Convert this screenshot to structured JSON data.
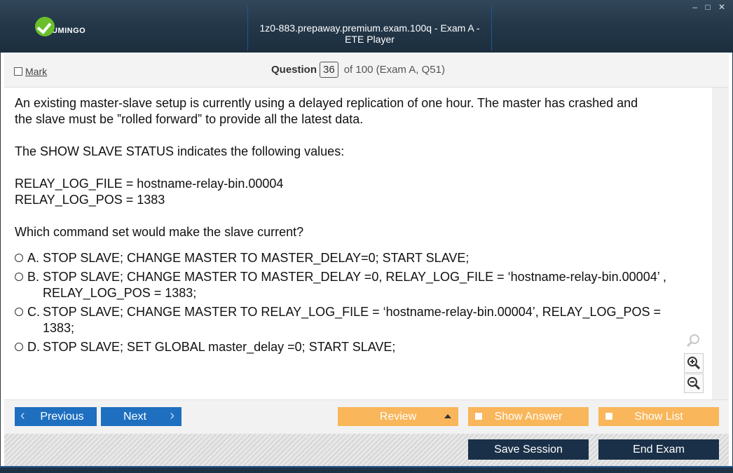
{
  "window": {
    "logo_text": "UMINGO",
    "title": "1z0-883.prepaway.premium.exam.100q - Exam A - ETE Player",
    "controls": [
      "–",
      "□",
      "✕"
    ]
  },
  "header": {
    "mark_label": "Mark",
    "question_label": "Question",
    "question_number": "36",
    "question_of": "of 100 (Exam A, Q51)"
  },
  "question": {
    "lines": [
      "An existing master-slave setup is currently using a delayed replication of one hour. The master has crashed and",
      "the slave must be ”rolled forward” to provide all the latest data.",
      "The SHOW SLAVE STATUS indicates the following values:",
      "RELAY_LOG_FILE = hostname-relay-bin.00004",
      "RELAY_LOG_POS = 1383",
      "Which command set would make the slave current?"
    ],
    "options": [
      {
        "letter": "A.",
        "text": "STOP SLAVE; CHANGE MASTER TO MASTER_DELAY=0; START SLAVE;"
      },
      {
        "letter": "B.",
        "text": "STOP SLAVE; CHANGE MASTER TO MASTER_DELAY =0, RELAY_LOG_FILE = ‘hostname-relay-bin.00004’ , RELAY_LOG_POS = 1383;"
      },
      {
        "letter": "C.",
        "text": "STOP SLAVE; CHANGE MASTER TO RELAY_LOG_FILE = ‘hostname-relay-bin.00004’, RELAY_LOG_POS = 1383;"
      },
      {
        "letter": "D.",
        "text": "STOP  SLAVE; SET GLOBAL master_delay =0; START SLAVE;"
      }
    ]
  },
  "nav": {
    "previous": "Previous",
    "next": "Next",
    "review": "Review",
    "show_answer": "Show Answer",
    "show_list": "Show List",
    "save_session": "Save Session",
    "end_exam": "End Exam"
  },
  "colors": {
    "title_bar": "#24384a",
    "nav_blue": "#1e6fc0",
    "nav_orange": "#f9b65a",
    "dark_button": "#1a3048"
  }
}
